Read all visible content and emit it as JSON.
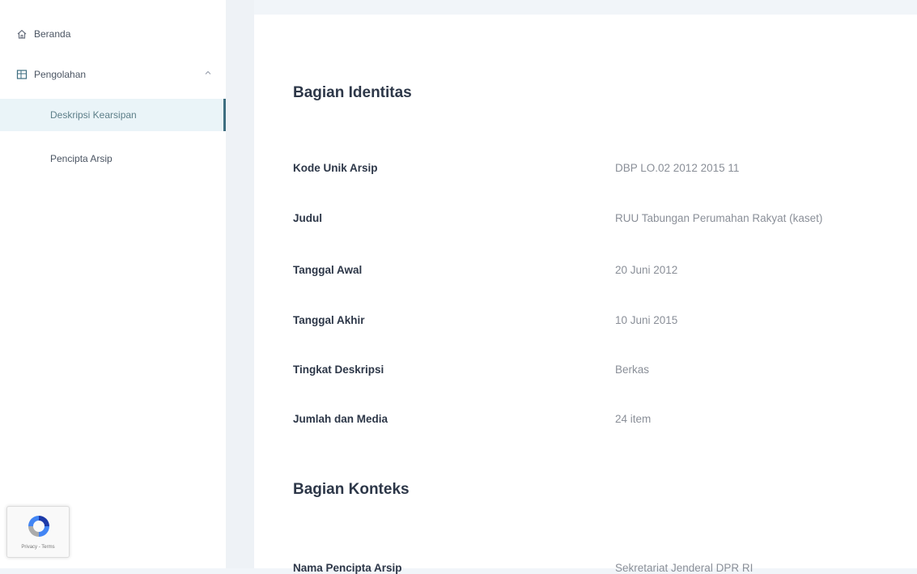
{
  "sidebar": {
    "home_label": "Beranda",
    "menu_label": "Pengolahan",
    "sub_items": [
      "Deskripsi Kearsipan",
      "Pencipta Arsip"
    ]
  },
  "main": {
    "identity_title": "Bagian Identitas",
    "fields": [
      {
        "label": "Kode Unik Arsip",
        "value": "DBP LO.02 2012 2015 11"
      },
      {
        "label": "Judul",
        "value": "RUU Tabungan Perumahan Rakyat (kaset)"
      },
      {
        "label": "Tanggal Awal",
        "value": "20 Juni 2012"
      },
      {
        "label": "Tanggal Akhir",
        "value": "10 Juni 2015"
      },
      {
        "label": "Tingkat Deskripsi",
        "value": "Berkas"
      },
      {
        "label": "Jumlah dan Media",
        "value": "24 item"
      }
    ],
    "context_title": "Bagian Konteks",
    "context_fields": [
      {
        "label": "Nama Pencipta Arsip",
        "value": "Sekretariat Jenderal DPR RI"
      }
    ]
  },
  "recaptcha": {
    "footer": "Privacy - Terms"
  },
  "colors": {
    "active_accent": "#3e6e80",
    "active_bg": "#eaf4f8"
  }
}
